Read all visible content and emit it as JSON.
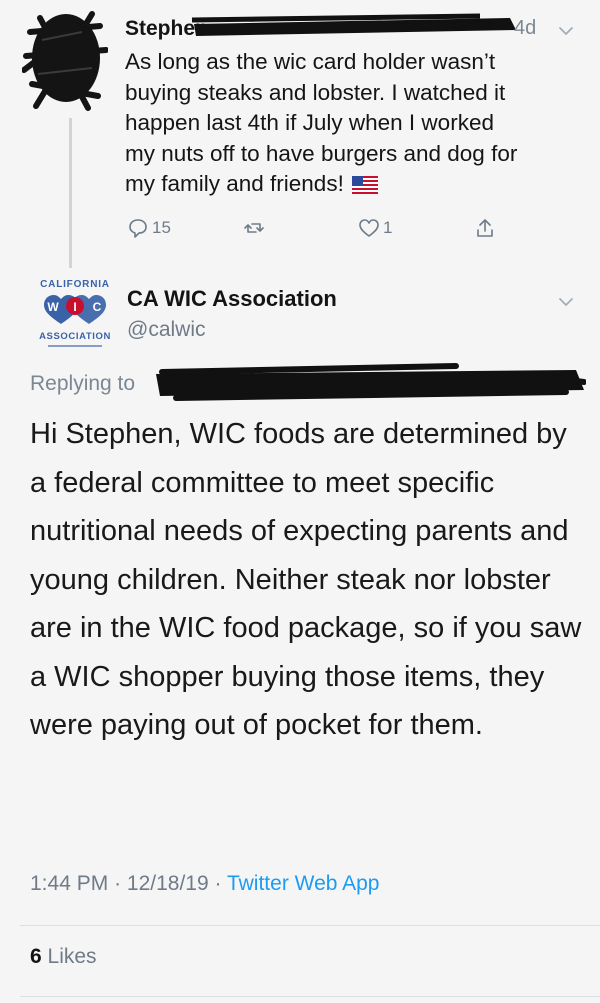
{
  "parent_tweet": {
    "author_name": "Stephen",
    "time": "4d",
    "text": "As long as the wic card holder wasn’t\nbuying steaks and lobster. I watched it\nhappen last 4th if July when I worked\nmy nuts off to have burgers and dog for\nmy family and friends!",
    "flag_icon": "us-flag-icon",
    "actions": {
      "reply_count": "15",
      "retweet_count": "",
      "like_count": "1"
    }
  },
  "main_tweet": {
    "account_name": "CA WIC Association",
    "handle": "@calwic",
    "logo": {
      "top": "CALIFORNIA",
      "letters": [
        "W",
        "I",
        "C"
      ],
      "bottom": "ASSOCIATION"
    },
    "replying_label": "Replying to",
    "text": "Hi Stephen, WIC foods are determined by a federal committee to meet specific nutritional needs of expecting parents and young children. Neither steak nor lobster are in the WIC food package, so if you saw a WIC shopper buying those items, they were paying out of pocket for them.",
    "time": "1:44 PM",
    "date": "12/18/19",
    "separator": "·",
    "source": "Twitter Web App",
    "likes_count": "6",
    "likes_label": "Likes"
  },
  "colors": {
    "background": "#f5f5f5",
    "secondary_text": "#6f7b88",
    "link_blue": "#1d9bf0",
    "logo_blue": "#3a62a8",
    "redaction": "#111111"
  }
}
